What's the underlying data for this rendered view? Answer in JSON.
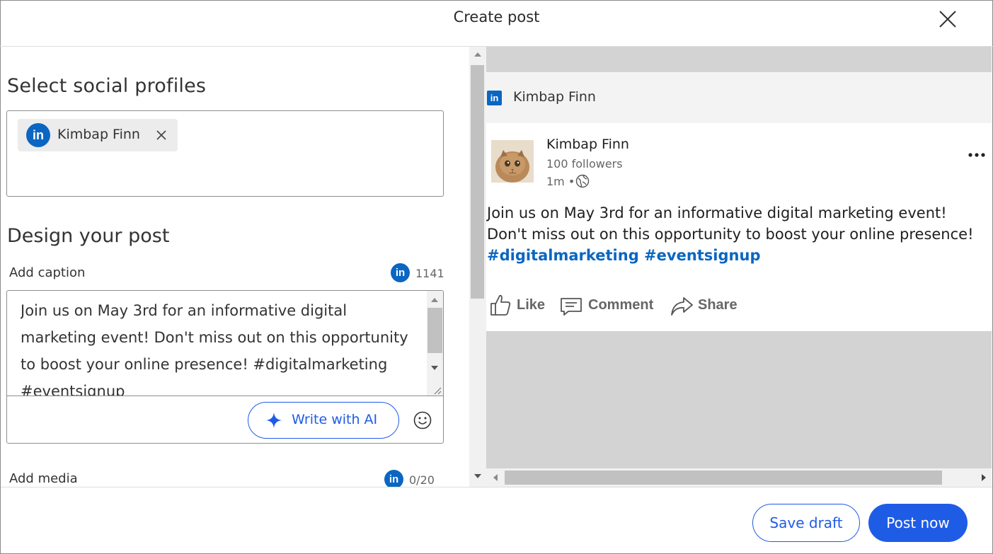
{
  "header": {
    "title": "Create post",
    "close_icon": "close-icon"
  },
  "left": {
    "select_heading": "Select social profiles",
    "selected_profile": {
      "network_icon": "linkedin-icon",
      "network_glyph": "in",
      "name": "Kimbap Finn",
      "remove_icon": "close-icon"
    },
    "design_heading": "Design your post",
    "caption": {
      "label": "Add caption",
      "network_glyph": "in",
      "char_count": "1141",
      "text": "Join us on May 3rd for an informative digital marketing event! Don't miss out on this opportunity to boost your online presence! #digitalmarketing #eventsignup",
      "ai_button_label": "Write with AI",
      "ai_icon": "sparkle-icon",
      "emoji_icon": "smiley-icon"
    },
    "media": {
      "label": "Add media",
      "network_glyph": "in",
      "count": "0/20"
    }
  },
  "preview": {
    "profile_bar": {
      "network_glyph": "in",
      "name": "Kimbap Finn"
    },
    "post": {
      "author": "Kimbap Finn",
      "followers": "100 followers",
      "time": "1m •",
      "avatar_icon": "cat-avatar",
      "visibility_icon": "globe-icon",
      "more_icon": "more-dots-icon",
      "line1": "Join us on May 3rd for an informative digital marketing event!",
      "line2": "Don't miss out on this opportunity to boost your online presence!",
      "tags": "#digitalmarketing #eventsignup",
      "actions": {
        "like": "Like",
        "comment": "Comment",
        "share": "Share"
      }
    }
  },
  "footer": {
    "save_draft": "Save draft",
    "post_now": "Post now"
  },
  "colors": {
    "accent": "#1f5ce6",
    "linkedin": "#0a66c2",
    "preview_bg": "#d3d3d3"
  }
}
